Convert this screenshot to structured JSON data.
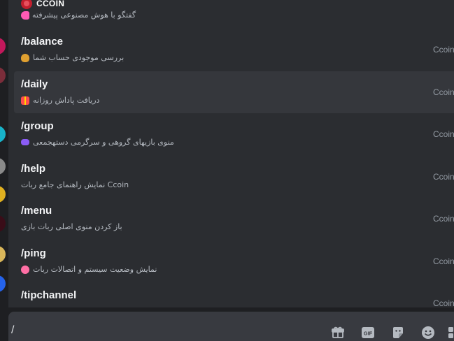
{
  "header": {
    "bot_name": "CCOIN",
    "icon": "ccoin-logo-icon",
    "prev_description": "گفتگو با هوش مصنوعی پیشرفته",
    "prev_emoji": "hand-emoji-icon"
  },
  "commands": [
    {
      "name": "/balance",
      "description": "بررسی موجودی حساب شما",
      "emoji": "money-bag-emoji-icon",
      "source": "Ccoin"
    },
    {
      "name": "/daily",
      "description": "دریافت پاداش روزانه",
      "emoji": "gift-emoji-icon",
      "source": "Ccoin"
    },
    {
      "name": "/group",
      "description": "منوی بازیهای گروهی و سرگرمی دستهجمعی",
      "emoji": "gamepad-emoji-icon",
      "source": "Ccoin"
    },
    {
      "name": "/help",
      "description": "نمایش راهنمای جامع ربات Ccoin",
      "emoji": "",
      "source": "Ccoin"
    },
    {
      "name": "/menu",
      "description": "باز کردن منوی اصلی ربات بازی",
      "emoji": "",
      "source": "Ccoin"
    },
    {
      "name": "/ping",
      "description": "نمایش وضعیت سیستم و اتصالات ربات",
      "emoji": "candy-emoji-icon",
      "source": "Ccoin"
    },
    {
      "name": "/tipchannel",
      "description": "",
      "emoji": "",
      "source": "Ccoin"
    }
  ],
  "active_command_index": 1,
  "input": {
    "value": "/"
  },
  "toolbar": {
    "icons": [
      "gift-icon",
      "gif-icon",
      "sticker-icon",
      "emoji-icon",
      "apps-icon"
    ],
    "gif_label": "GIF"
  },
  "colors": {
    "popup_bg": "#2b2d31",
    "active_row": "#35373c",
    "input_bg": "#383a40",
    "app_bg": "#1e1f22",
    "text_primary": "#f2f3f5",
    "text_muted": "#949ba4",
    "ccoin_red": "#c21f2e"
  }
}
